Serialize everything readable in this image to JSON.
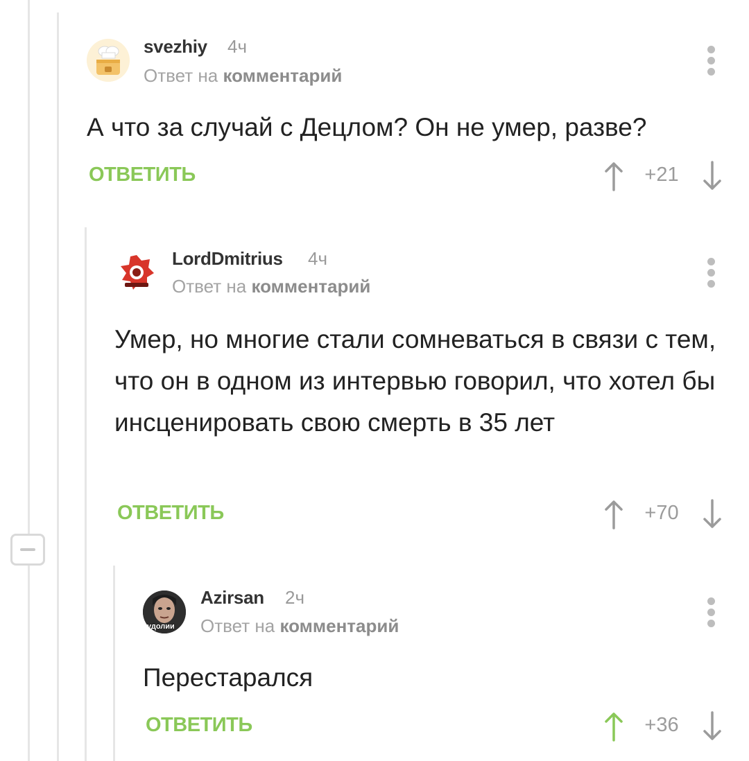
{
  "labels": {
    "reply_to_prefix": "Ответ на",
    "reply_to_target": "комментарий",
    "reply_button": "ОТВЕТИТЬ"
  },
  "colors": {
    "accent": "#8ac858",
    "upvoted": "#8ac858",
    "muted": "#9b9b9b"
  },
  "comments": [
    {
      "username": "svezhiy",
      "time": "4ч",
      "text": "А что за случай с Децлом? Он не умер, разве?",
      "rating": "+21",
      "upvoted": false,
      "avatar": "chef-hat-avatar"
    },
    {
      "username": "LordDmitrius",
      "time": "4ч",
      "text": "Умер, но многие стали сомневаться в связи с тем, что он в одном из интервью говорил, что хотел бы инсценировать свою смерть в 35 лет",
      "rating": "+70",
      "upvoted": false,
      "avatar": "red-emblem-avatar"
    },
    {
      "username": "Azirsan",
      "time": "2ч",
      "text": "Перестарался",
      "rating": "+36",
      "upvoted": true,
      "avatar": "face-photo-avatar",
      "avatar_caption": "удолии"
    }
  ]
}
